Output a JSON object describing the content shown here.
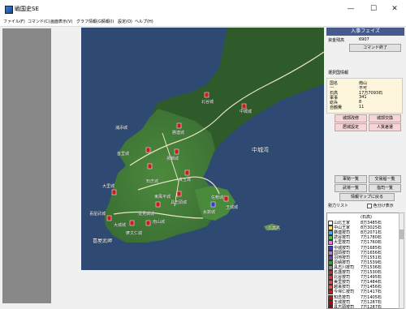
{
  "window": {
    "title": "戦国史SE",
    "minimize": "—",
    "maximize": "☐",
    "close": "✕"
  },
  "menus": [
    "ファイル(F)",
    "コマンド(C)",
    "画面表示(V)",
    "グラフ情報(G)",
    "情報(I)",
    "設定(O)",
    "ヘルプ(H)"
  ],
  "map": {
    "sea_label": "中城湾",
    "cape_label": "喜屋武岬",
    "island_label": "久高島",
    "towns": [
      "北谷城",
      "中城城",
      "勝連城",
      "浦添城",
      "首里城",
      "那覇城",
      "真玉城",
      "大里城",
      "知念城",
      "東風平城",
      "具志頭城",
      "佐敷城",
      "玉城城",
      "糸数城",
      "豊見城城",
      "南山城",
      "大城城",
      "喜屋武城",
      "摩文仁城"
    ]
  },
  "side": {
    "phase_title": "入事フェイズ",
    "funds_label": "資金残高",
    "funds_value": "6907",
    "end_command_button": "コマンド終了",
    "info_header": "選択国情報",
    "info_rows": [
      {
        "label": "国名",
        "value": "南山"
      },
      {
        "label": "---",
        "value": "不可"
      },
      {
        "label": "石高",
        "value": "17万7093石"
      },
      {
        "label": "軍事",
        "value": "341"
      },
      {
        "label": "総兵",
        "value": "8"
      },
      {
        "label": "自鶴費",
        "value": "11"
      }
    ],
    "buttons": [
      "城郭改修",
      "城郭交換",
      "居城設定",
      "人質差遣",
      "軍勢一覧",
      "交易船一覧",
      "武将一覧",
      "指司一覧",
      "情報マップに戻る"
    ],
    "list_title": "勢力リスト",
    "checkbox_label": "色分け表示",
    "list_header_name": "",
    "list_header_stat": "(石高)",
    "factions": [
      {
        "name": "山北王家",
        "value": "8万3485石",
        "color": "#ffffff"
      },
      {
        "name": "中山王家",
        "value": "8万3025石",
        "color": "#f5e062"
      },
      {
        "name": "勝連按司",
        "value": "8万2071石",
        "color": "#3ab0e6"
      },
      {
        "name": "読谷按司",
        "value": "7万1780石",
        "color": "#3cc24a"
      },
      {
        "name": "大里按司",
        "value": "7万1760石",
        "color": "#e07de0"
      },
      {
        "name": "中城按司",
        "value": "7万1685石",
        "color": "#3c3cc4"
      },
      {
        "name": "国頭按司",
        "value": "7万1656石",
        "color": "#b07cd0"
      },
      {
        "name": "羽地按司",
        "value": "7万1551石",
        "color": "#6a4c9c"
      },
      {
        "name": "恩納按司",
        "value": "7万1539石",
        "color": "#3c9c3c"
      },
      {
        "name": "具志川按司",
        "value": "7万1536石",
        "color": "#888888"
      },
      {
        "name": "名護按司",
        "value": "7万1530石",
        "color": "#9c3c3c"
      },
      {
        "name": "北谷按司",
        "value": "7万1495石",
        "color": "#c43c3c"
      },
      {
        "name": "美里按司",
        "value": "7万1484石",
        "color": "#d04c4c"
      },
      {
        "name": "越来按司",
        "value": "7万1456石",
        "color": "#e05050"
      },
      {
        "name": "今帰仁按司",
        "value": "7万1417石",
        "color": "#c02020"
      },
      {
        "name": "知念按司",
        "value": "7万1405石",
        "color": "#b01818"
      },
      {
        "name": "玉城按司",
        "value": "7万1287石",
        "color": "#a01010"
      },
      {
        "name": "具志頭按司",
        "value": "7万1287石",
        "color": "#900808"
      }
    ]
  }
}
